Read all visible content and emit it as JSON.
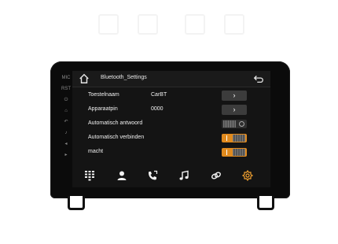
{
  "window": {
    "title": "Bluetooth_Settings"
  },
  "side_keys": [
    "MIC",
    "RST",
    "⏻",
    "⌂",
    "↶",
    "♪",
    "◂",
    "▸"
  ],
  "rows": [
    {
      "label": "Toestelnaam",
      "value": "CarBT",
      "control": "chevron-button"
    },
    {
      "label": "Apparaatpin",
      "value": "0000",
      "control": "chevron-button"
    },
    {
      "label": "Automatisch antwoord",
      "value": "",
      "control": "toggle",
      "state": "off"
    },
    {
      "label": "Automatisch verbinden",
      "value": "",
      "control": "toggle",
      "state": "on"
    },
    {
      "label": "macht",
      "value": "",
      "control": "toggle",
      "state": "on"
    }
  ],
  "dock": [
    "dialpad-icon",
    "contacts-icon",
    "call-log-icon",
    "music-icon",
    "link-icon",
    "bluetooth-settings-icon"
  ],
  "colors": {
    "accent": "#e08a1e",
    "screen_bg": "#141414",
    "bezel": "#0b0b0b"
  }
}
